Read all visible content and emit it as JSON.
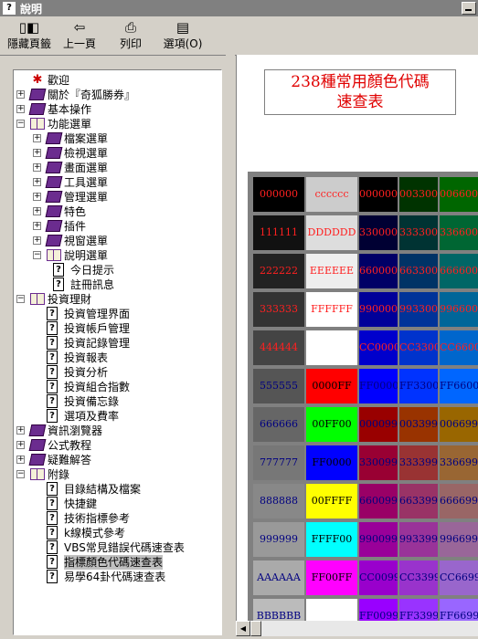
{
  "window": {
    "title": "說明"
  },
  "toolbar": {
    "hide_tabs": "隱藏頁籤",
    "back": "上一頁",
    "print": "列印",
    "options": "選項(O)"
  },
  "tree": [
    {
      "label": "歡迎",
      "icon": "star-page",
      "toggle": ""
    },
    {
      "label": "關於『奇狐勝券』",
      "icon": "book-closed",
      "toggle": "+"
    },
    {
      "label": "基本操作",
      "icon": "book-closed",
      "toggle": "+"
    },
    {
      "label": "功能選單",
      "icon": "book-open",
      "toggle": "−"
    },
    {
      "label": "檔案選單",
      "icon": "book-closed",
      "toggle": "+"
    },
    {
      "label": "檢視選單",
      "icon": "book-closed",
      "toggle": "+"
    },
    {
      "label": "畫面選單",
      "icon": "book-closed",
      "toggle": "+"
    },
    {
      "label": "工具選單",
      "icon": "book-closed",
      "toggle": "+"
    },
    {
      "label": "管理選單",
      "icon": "book-closed",
      "toggle": "+"
    },
    {
      "label": "特色",
      "icon": "book-closed",
      "toggle": "+"
    },
    {
      "label": "插件",
      "icon": "book-closed",
      "toggle": "+"
    },
    {
      "label": "視窗選單",
      "icon": "book-closed",
      "toggle": "+"
    },
    {
      "label": "說明選單",
      "icon": "book-open",
      "toggle": "−"
    },
    {
      "label": "今日提示",
      "icon": "help-page",
      "toggle": ""
    },
    {
      "label": "註冊訊息",
      "icon": "help-page",
      "toggle": ""
    },
    {
      "label": "投資理財",
      "icon": "book-open",
      "toggle": "−"
    },
    {
      "label": "投資管理界面",
      "icon": "help-page",
      "toggle": ""
    },
    {
      "label": "投資帳戶管理",
      "icon": "help-page",
      "toggle": ""
    },
    {
      "label": "投資記錄管理",
      "icon": "help-page",
      "toggle": ""
    },
    {
      "label": "投資報表",
      "icon": "help-page",
      "toggle": ""
    },
    {
      "label": "投資分析",
      "icon": "help-page",
      "toggle": ""
    },
    {
      "label": "投資組合指數",
      "icon": "help-page",
      "toggle": ""
    },
    {
      "label": "投資備忘錄",
      "icon": "help-page",
      "toggle": ""
    },
    {
      "label": "選項及費率",
      "icon": "help-page",
      "toggle": ""
    },
    {
      "label": "資訊瀏覽器",
      "icon": "book-closed",
      "toggle": "+"
    },
    {
      "label": "公式教程",
      "icon": "book-closed",
      "toggle": "+"
    },
    {
      "label": "疑難解答",
      "icon": "book-closed",
      "toggle": "+"
    },
    {
      "label": "附錄",
      "icon": "book-open",
      "toggle": "−"
    },
    {
      "label": "目錄結構及檔案",
      "icon": "help-page",
      "toggle": ""
    },
    {
      "label": "快捷鍵",
      "icon": "help-page",
      "toggle": ""
    },
    {
      "label": "技術指標參考",
      "icon": "help-page",
      "toggle": ""
    },
    {
      "label": "k線模式參考",
      "icon": "help-page",
      "toggle": ""
    },
    {
      "label": "VBS常見錯誤代碼速查表",
      "icon": "help-page",
      "toggle": ""
    },
    {
      "label": "指標顏色代碼速查表",
      "icon": "help-page",
      "toggle": "",
      "selected": true
    },
    {
      "label": "易學64卦代碼速查表",
      "icon": "help-page",
      "toggle": ""
    }
  ],
  "content": {
    "title_line1": "238種常用顏色代碼",
    "title_line2": "速查表"
  },
  "colors": {
    "accent_red": "#e00000",
    "selection": "#c0c0c0",
    "rows": [
      [
        {
          "text": "000000",
          "bg": "#000000",
          "fg": "#ff2020"
        },
        {
          "text": "cccccc",
          "bg": "#cccccc",
          "fg": "#ff2020"
        },
        {
          "text": "000000",
          "bg": "#000000",
          "fg": "#ff2020"
        },
        {
          "text": "003300",
          "bg": "#003300",
          "fg": "#ff2020"
        },
        {
          "text": "006600",
          "bg": "#006600",
          "fg": "#ff2020"
        }
      ],
      [
        {
          "text": "111111",
          "bg": "#111111",
          "fg": "#ff2020"
        },
        {
          "text": "DDDDDD",
          "bg": "#dddddd",
          "fg": "#ff2020"
        },
        {
          "text": "330000",
          "bg": "#000033",
          "fg": "#ff2020"
        },
        {
          "text": "333300",
          "bg": "#003333",
          "fg": "#ff2020"
        },
        {
          "text": "336600",
          "bg": "#006633",
          "fg": "#ff2020"
        }
      ],
      [
        {
          "text": "222222",
          "bg": "#222222",
          "fg": "#ff2020"
        },
        {
          "text": "EEEEEE",
          "bg": "#eeeeee",
          "fg": "#ff2020"
        },
        {
          "text": "660000",
          "bg": "#000066",
          "fg": "#ff2020"
        },
        {
          "text": "663300",
          "bg": "#003366",
          "fg": "#ff2020"
        },
        {
          "text": "666600",
          "bg": "#006666",
          "fg": "#ff2020"
        }
      ],
      [
        {
          "text": "333333",
          "bg": "#333333",
          "fg": "#ff2020"
        },
        {
          "text": "FFFFFF",
          "bg": "#ffffff",
          "fg": "#ff2020"
        },
        {
          "text": "990000",
          "bg": "#000099",
          "fg": "#ff2020"
        },
        {
          "text": "993300",
          "bg": "#003399",
          "fg": "#ff2020"
        },
        {
          "text": "996600",
          "bg": "#006699",
          "fg": "#ff2020"
        }
      ],
      [
        {
          "text": "444444",
          "bg": "#444444",
          "fg": "#ff2020"
        },
        {
          "text": "",
          "bg": "#ffffff",
          "fg": "#ff2020"
        },
        {
          "text": "CC0000",
          "bg": "#0000cc",
          "fg": "#ff2020"
        },
        {
          "text": "CC3300",
          "bg": "#0033cc",
          "fg": "#ff2020"
        },
        {
          "text": "CC6600",
          "bg": "#0066cc",
          "fg": "#ff2020"
        }
      ],
      [
        {
          "text": "555555",
          "bg": "#555555",
          "fg": "#000080"
        },
        {
          "text": "0000FF",
          "bg": "#ff0000",
          "fg": "#000000"
        },
        {
          "text": "FF0000",
          "bg": "#0000ff",
          "fg": "#000080"
        },
        {
          "text": "FF3300",
          "bg": "#0033ff",
          "fg": "#000080"
        },
        {
          "text": "FF6600",
          "bg": "#0066ff",
          "fg": "#000080"
        }
      ],
      [
        {
          "text": "666666",
          "bg": "#666666",
          "fg": "#000080"
        },
        {
          "text": "00FF00",
          "bg": "#00ff00",
          "fg": "#000000"
        },
        {
          "text": "000099",
          "bg": "#990000",
          "fg": "#000080"
        },
        {
          "text": "003399",
          "bg": "#993300",
          "fg": "#000080"
        },
        {
          "text": "006699",
          "bg": "#996600",
          "fg": "#000080"
        }
      ],
      [
        {
          "text": "777777",
          "bg": "#777777",
          "fg": "#000080"
        },
        {
          "text": "FF0000",
          "bg": "#0000ff",
          "fg": "#000000"
        },
        {
          "text": "330099",
          "bg": "#990033",
          "fg": "#000080"
        },
        {
          "text": "333399",
          "bg": "#993333",
          "fg": "#000080"
        },
        {
          "text": "336699",
          "bg": "#996633",
          "fg": "#000080"
        }
      ],
      [
        {
          "text": "888888",
          "bg": "#888888",
          "fg": "#000080"
        },
        {
          "text": "00FFFF",
          "bg": "#ffff00",
          "fg": "#000000"
        },
        {
          "text": "660099",
          "bg": "#990066",
          "fg": "#000080"
        },
        {
          "text": "663399",
          "bg": "#993366",
          "fg": "#000080"
        },
        {
          "text": "666699",
          "bg": "#996666",
          "fg": "#000080"
        }
      ],
      [
        {
          "text": "999999",
          "bg": "#999999",
          "fg": "#000080"
        },
        {
          "text": "FFFF00",
          "bg": "#00ffff",
          "fg": "#000000"
        },
        {
          "text": "990099",
          "bg": "#990099",
          "fg": "#000080"
        },
        {
          "text": "993399",
          "bg": "#993399",
          "fg": "#000080"
        },
        {
          "text": "996699",
          "bg": "#996699",
          "fg": "#000080"
        }
      ],
      [
        {
          "text": "AAAAAA",
          "bg": "#aaaaaa",
          "fg": "#000080"
        },
        {
          "text": "FF00FF",
          "bg": "#ff00ff",
          "fg": "#000000"
        },
        {
          "text": "CC0099",
          "bg": "#9900cc",
          "fg": "#000080"
        },
        {
          "text": "CC3399",
          "bg": "#9933cc",
          "fg": "#000080"
        },
        {
          "text": "CC6699",
          "bg": "#9966cc",
          "fg": "#000080"
        }
      ],
      [
        {
          "text": "BBBBBB",
          "bg": "#bbbbbb",
          "fg": "#000080"
        },
        {
          "text": "",
          "bg": "#ffffff",
          "fg": "#000000"
        },
        {
          "text": "FF0099",
          "bg": "#9900ff",
          "fg": "#000080"
        },
        {
          "text": "FF3399",
          "bg": "#9933ff",
          "fg": "#000080"
        },
        {
          "text": "FF6699",
          "bg": "#9966ff",
          "fg": "#000080"
        }
      ]
    ]
  }
}
